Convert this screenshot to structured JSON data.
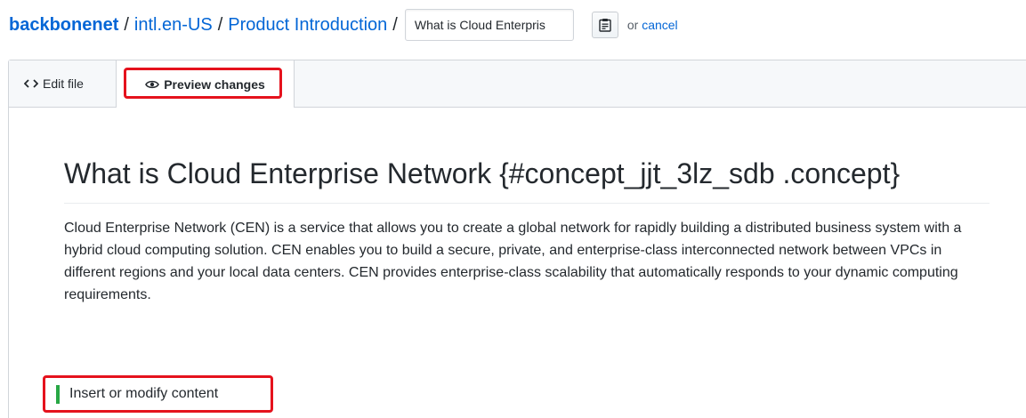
{
  "breadcrumb": {
    "owner": "backbonenet",
    "separator": "/",
    "path": [
      "intl.en-US",
      "Product Introduction"
    ],
    "filename_value": "What is Cloud Enterpris",
    "or_text": "or",
    "cancel_label": "cancel"
  },
  "tabs": {
    "edit_label": "Edit file",
    "preview_label": "Preview changes",
    "active": "preview"
  },
  "preview": {
    "title": "What is Cloud Enterprise Network {#concept_jjt_3lz_sdb .concept}",
    "paragraph": "Cloud Enterprise Network (CEN) is a service that allows you to create a global network for rapidly building a distributed business system with a hybrid cloud computing solution. CEN enables you to build a secure, private, and enterprise-class interconnected network between VPCs in different regions and your local data centers. CEN provides enterprise-class scalability that automatically responds to your dynamic computing requirements.",
    "inserted_line": "Insert or modify content"
  },
  "colors": {
    "link": "#0366d6",
    "highlight": "#e5121d",
    "added_marker": "#28a745"
  },
  "icons": {
    "edit_tab": "code-icon",
    "preview_tab": "eye-icon",
    "clipboard": "clipboard-icon"
  }
}
